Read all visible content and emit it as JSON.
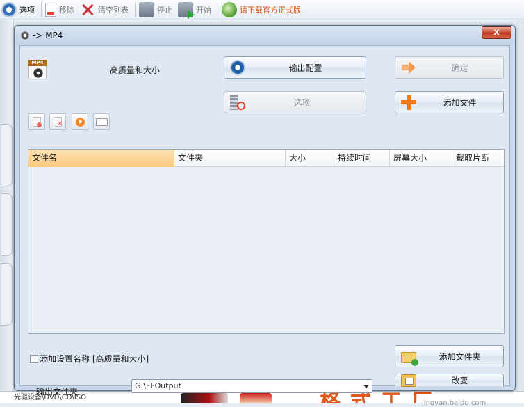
{
  "app_toolbar": {
    "options_label": "选项",
    "remove_label": "移除",
    "clear_list_label": "清空列表",
    "stop_label": "停止",
    "start_label": "开始",
    "download_label": "请下载官方正式版"
  },
  "status_bar": {
    "text": "光驱设备\\DVD\\CD\\ISO",
    "ad_text": "格式工厂"
  },
  "dialog": {
    "title": "-> MP4",
    "close_label": "x",
    "format_badge": "MP4",
    "quality_label": "高质量和大小",
    "output_config_label": "输出配置",
    "ok_label": "确定",
    "options_label": "选项",
    "add_file_label": "添加文件",
    "add_folder_label": "添加文件夹",
    "change_label": "改变",
    "add_setting_label": "添加设置名称 [高质量和大小]",
    "output_folder_label": "输出文件夹",
    "output_folder_value": "G:\\FFOutput",
    "columns": [
      "文件名",
      "文件夹",
      "大小",
      "持续时间",
      "屏幕大小",
      "截取片断"
    ],
    "watermark": "jingyan.baidu.com"
  }
}
